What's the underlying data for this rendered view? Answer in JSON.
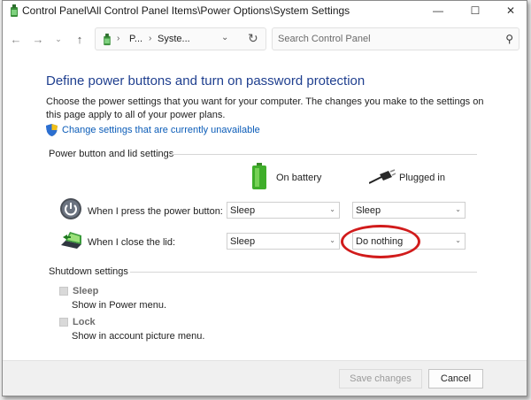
{
  "window": {
    "title": "Control Panel\\All Control Panel Items\\Power Options\\System Settings",
    "controls": {
      "minimize": "—",
      "maximize": "☐",
      "close": "✕"
    }
  },
  "nav": {
    "back": "←",
    "forward": "→",
    "recent": "⌄",
    "up": "↑",
    "breadcrumb": [
      "P...",
      "Syste..."
    ],
    "crumb_separator": "›",
    "dropdown": "⌄",
    "refresh": "↻",
    "search_placeholder": "Search Control Panel",
    "search_value": ""
  },
  "page": {
    "title": "Define power buttons and turn on password protection",
    "intro": "Choose the power settings that you want for your computer. The changes you make to the settings on this page apply to all of your power plans.",
    "change_link": "Change settings that are currently unavailable"
  },
  "power_group": {
    "label": "Power button and lid settings",
    "col_battery": "On battery",
    "col_plugged": "Plugged in",
    "rows": [
      {
        "label": "When I press the power button:",
        "battery": "Sleep",
        "plugged": "Sleep"
      },
      {
        "label": "When I close the lid:",
        "battery": "Sleep",
        "plugged": "Do nothing"
      }
    ]
  },
  "shutdown_group": {
    "label": "Shutdown settings",
    "items": [
      {
        "label": "Sleep",
        "desc": "Show in Power menu.",
        "checked": false
      },
      {
        "label": "Lock",
        "desc": "Show in account picture menu.",
        "checked": false
      }
    ]
  },
  "footer": {
    "save_label": "Save changes",
    "cancel_label": "Cancel"
  },
  "colors": {
    "title_blue": "#1f3f8f",
    "link_blue": "#0b5cb8",
    "highlight_red": "#d11b1b"
  },
  "icons": {
    "app": "control-panel-icon",
    "shield": "uac-shield-icon",
    "battery": "battery-icon",
    "plug": "power-plug-icon",
    "power_button": "power-button-icon",
    "lid": "laptop-lid-icon"
  }
}
